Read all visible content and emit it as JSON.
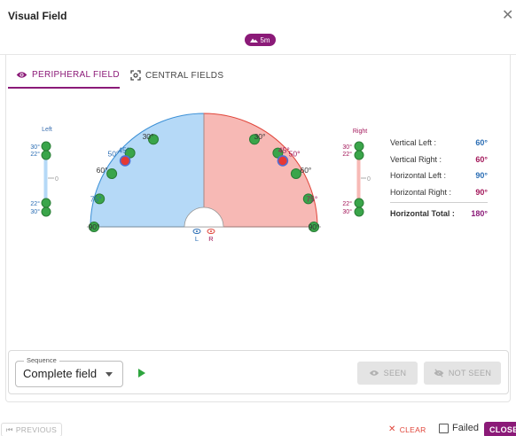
{
  "window": {
    "title": "Visual Field",
    "close_icon": "close-icon"
  },
  "badge": {
    "icon": "mountain-icon",
    "label": "5m"
  },
  "tabs": [
    {
      "label": "PERIPHERAL FIELD",
      "icon": "eye-icon",
      "active": true
    },
    {
      "label": "CENTRAL FIELDS",
      "icon": "focus-icon",
      "active": false
    }
  ],
  "colors": {
    "accent": "#8b1a78",
    "left_fill": "#b5d9f7",
    "left_stroke": "#3a8fd6",
    "right_fill": "#f7b9b5",
    "right_stroke": "#e0453a",
    "seen_dot": "#3aa54a",
    "missed_dot": "#e53935",
    "left_label": "#2a6db4",
    "right_label": "#a3175a"
  },
  "diagram": {
    "left_scale": {
      "title": "Left",
      "top": [
        "30°",
        "22°"
      ],
      "zero": "0",
      "bottom": [
        "22°",
        "30°"
      ]
    },
    "right_scale": {
      "title": "Right",
      "top": [
        "30°",
        "22°"
      ],
      "zero": "0",
      "bottom": [
        "22°",
        "30°"
      ]
    },
    "left_arc_labels": [
      "30°",
      "45°",
      "50°",
      "60°",
      "75°",
      "90°"
    ],
    "right_arc_labels": [
      "30°",
      "45°",
      "50°",
      "60°",
      "75°",
      "90°"
    ],
    "eye_left": "L",
    "eye_right": "R",
    "left_points": [
      {
        "angle_deg": 30,
        "status": "seen"
      },
      {
        "angle_deg": 45,
        "status": "seen"
      },
      {
        "angle_deg": 50,
        "status": "missed"
      },
      {
        "angle_deg": 60,
        "status": "seen"
      },
      {
        "angle_deg": 75,
        "status": "seen"
      },
      {
        "angle_deg": 90,
        "status": "seen"
      }
    ],
    "right_points": [
      {
        "angle_deg": 30,
        "status": "seen"
      },
      {
        "angle_deg": 45,
        "status": "seen"
      },
      {
        "angle_deg": 50,
        "status": "missed"
      },
      {
        "angle_deg": 60,
        "status": "seen"
      },
      {
        "angle_deg": 75,
        "status": "seen"
      },
      {
        "angle_deg": 90,
        "status": "seen"
      }
    ]
  },
  "stats": [
    {
      "label": "Vertical Left :",
      "value": "60°",
      "side": "left"
    },
    {
      "label": "Vertical Right :",
      "value": "60°",
      "side": "right"
    },
    {
      "label": "Horizontal Left :",
      "value": "90°",
      "side": "left"
    },
    {
      "label": "Horizontal Right :",
      "value": "90°",
      "side": "right"
    },
    {
      "label": "Horizontal Total :",
      "value": "180°",
      "side": "total"
    }
  ],
  "sequence": {
    "label": "Sequence",
    "value": "Complete field"
  },
  "buttons": {
    "seen": "SEEN",
    "not_seen": "NOT SEEN",
    "previous": "PREVIOUS",
    "clear": "CLEAR",
    "failed": "Failed",
    "close": "CLOSE"
  }
}
